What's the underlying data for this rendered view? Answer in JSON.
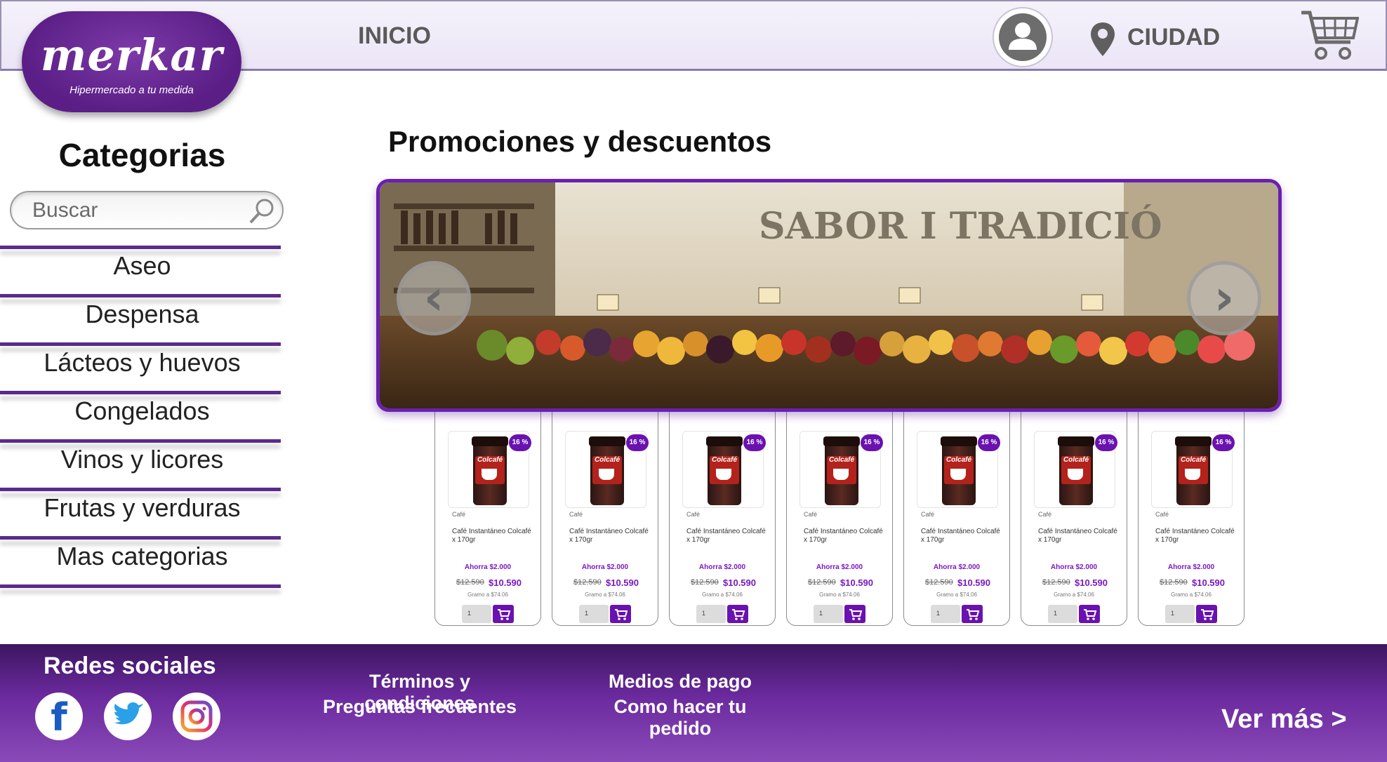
{
  "header": {
    "logo_brand": "merkar",
    "logo_tagline": "Hipermercado a tu medida",
    "nav_inicio": "INICIO",
    "city_label": "CIUDAD",
    "icons": {
      "user": "user-icon",
      "location": "location-pin-icon",
      "cart": "cart-icon"
    }
  },
  "sidebar": {
    "title": "Categorias",
    "search_placeholder": "Buscar",
    "items": [
      {
        "label": "Aseo"
      },
      {
        "label": "Despensa"
      },
      {
        "label": "Lácteos y huevos"
      },
      {
        "label": "Congelados"
      },
      {
        "label": "Vinos y licores"
      },
      {
        "label": "Frutas y verduras"
      },
      {
        "label": "Mas categorias"
      }
    ]
  },
  "promo": {
    "title": "Promociones y descuentos",
    "banner_sign": "SABOR I TRADICIÓ",
    "prev_icon": "chevron-left-icon",
    "next_icon": "chevron-right-icon"
  },
  "products": [
    {
      "badge": "16 %",
      "brand": "Colcafé",
      "category": "Café",
      "name": "Café Instantáneo Colcafé x 170gr",
      "savings": "Ahorra $2.000",
      "old_price": "$12.590",
      "new_price": "$10.590",
      "unit_price": "Gramo a $74.06",
      "qty": "1"
    },
    {
      "badge": "16 %",
      "brand": "Colcafé",
      "category": "Café",
      "name": "Café Instantáneo Colcafé x 170gr",
      "savings": "Ahorra $2.000",
      "old_price": "$12.590",
      "new_price": "$10.590",
      "unit_price": "Gramo a $74.06",
      "qty": "1"
    },
    {
      "badge": "16 %",
      "brand": "Colcafé",
      "category": "Café",
      "name": "Café Instantáneo Colcafé x 170gr",
      "savings": "Ahorra $2.000",
      "old_price": "$12.590",
      "new_price": "$10.590",
      "unit_price": "Gramo a $74.06",
      "qty": "1"
    },
    {
      "badge": "16 %",
      "brand": "Colcafé",
      "category": "Café",
      "name": "Café Instantáneo Colcafé x 170gr",
      "savings": "Ahorra $2.000",
      "old_price": "$12.590",
      "new_price": "$10.590",
      "unit_price": "Gramo a $74.06",
      "qty": "1"
    },
    {
      "badge": "16 %",
      "brand": "Colcafé",
      "category": "Café",
      "name": "Café Instantáneo Colcafé x 170gr",
      "savings": "Ahorra $2.000",
      "old_price": "$12.590",
      "new_price": "$10.590",
      "unit_price": "Gramo a $74.06",
      "qty": "1"
    },
    {
      "badge": "16 %",
      "brand": "Colcafé",
      "category": "Café",
      "name": "Café Instantáneo Colcafé x 170gr",
      "savings": "Ahorra $2.000",
      "old_price": "$12.590",
      "new_price": "$10.590",
      "unit_price": "Gramo a $74.06",
      "qty": "1"
    },
    {
      "badge": "16 %",
      "brand": "Colcafé",
      "category": "Café",
      "name": "Café Instantáneo Colcafé x 170gr",
      "savings": "Ahorra $2.000",
      "old_price": "$12.590",
      "new_price": "$10.590",
      "unit_price": "Gramo a $74.06",
      "qty": "1"
    }
  ],
  "footer": {
    "social_title": "Redes sociales",
    "social_icons": [
      "facebook-icon",
      "twitter-icon",
      "instagram-icon"
    ],
    "links": {
      "terms": "Términos y condiciones",
      "faq": "Preguntas frecuentes",
      "payment": "Medios de pago",
      "how_to_order": "Como hacer tu pedido"
    },
    "see_more": "Ver más >"
  },
  "colors": {
    "brand_purple": "#5b1e86",
    "accent_purple": "#6a12b0",
    "price_purple": "#7a18c0"
  }
}
